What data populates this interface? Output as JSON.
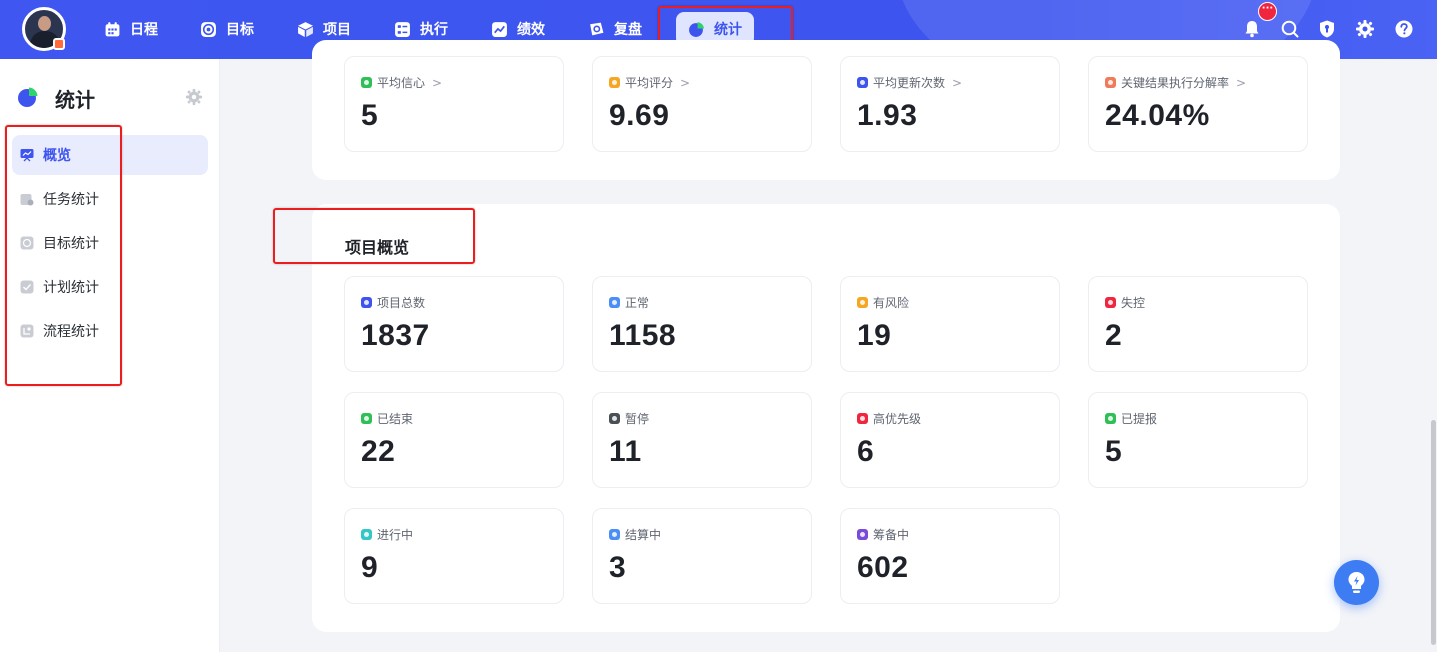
{
  "topnav": {
    "items": [
      {
        "label": "日程",
        "icon": "calendar-icon"
      },
      {
        "label": "目标",
        "icon": "target-icon"
      },
      {
        "label": "项目",
        "icon": "cube-icon"
      },
      {
        "label": "执行",
        "icon": "checklist-icon"
      },
      {
        "label": "绩效",
        "icon": "performance-icon"
      },
      {
        "label": "复盘",
        "icon": "review-icon"
      },
      {
        "label": "统计",
        "icon": "pie-chart-icon"
      }
    ],
    "active": "统计",
    "notification_badge": "···"
  },
  "sidebar": {
    "title": "统计",
    "items": [
      {
        "label": "概览",
        "active": true
      },
      {
        "label": "任务统计",
        "active": false
      },
      {
        "label": "目标统计",
        "active": false
      },
      {
        "label": "计划统计",
        "active": false
      },
      {
        "label": "流程统计",
        "active": false
      }
    ]
  },
  "okr_stats": [
    {
      "label": "平均信心",
      "value": "5",
      "color": "#2fbf57",
      "chevron": ">"
    },
    {
      "label": "平均评分",
      "value": "9.69",
      "color": "#f5a623",
      "chevron": ">"
    },
    {
      "label": "平均更新次数",
      "value": "1.93",
      "color": "#3d54ef",
      "chevron": ">"
    },
    {
      "label": "关键结果执行分解率",
      "value": "24.04%",
      "color": "#f07a5a",
      "chevron": ">"
    }
  ],
  "project_overview": {
    "title": "项目概览",
    "stats": [
      {
        "label": "项目总数",
        "value": "1837",
        "color": "#3d54ef"
      },
      {
        "label": "正常",
        "value": "1158",
        "color": "#4b8ef5"
      },
      {
        "label": "有风险",
        "value": "19",
        "color": "#f5a623"
      },
      {
        "label": "失控",
        "value": "2",
        "color": "#f0263e"
      },
      {
        "label": "已结束",
        "value": "22",
        "color": "#2fbf57"
      },
      {
        "label": "暂停",
        "value": "11",
        "color": "#4a4f57"
      },
      {
        "label": "高优先级",
        "value": "6",
        "color": "#f0263e"
      },
      {
        "label": "已提报",
        "value": "5",
        "color": "#2fbf57"
      },
      {
        "label": "进行中",
        "value": "9",
        "color": "#35c6c6"
      },
      {
        "label": "结算中",
        "value": "3",
        "color": "#4b8ef5"
      },
      {
        "label": "筹备中",
        "value": "602",
        "color": "#7a4bd8"
      }
    ]
  }
}
